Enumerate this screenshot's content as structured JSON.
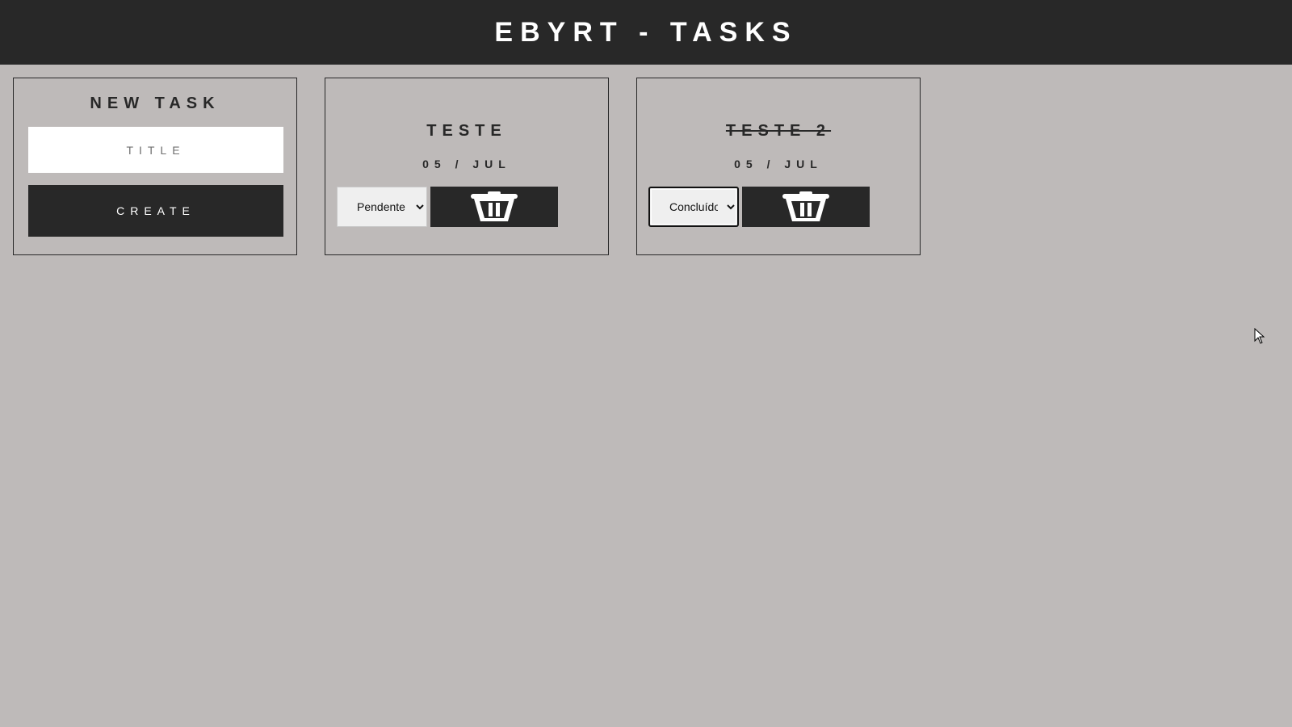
{
  "app": {
    "title": "EBYRT - TASKS"
  },
  "new_task": {
    "heading": "NEW TASK",
    "title_input": {
      "placeholder": "TITLE",
      "value": ""
    },
    "create_label": "CREATE"
  },
  "tasks": [
    {
      "title": "TESTE",
      "date": "05 / JUL",
      "status": "Pendente",
      "completed": false,
      "delete_icon": "trash-icon"
    },
    {
      "title": "TESTE 2",
      "date": "05 / JUL",
      "status": "Concluído",
      "completed": true,
      "delete_icon": "trash-icon"
    }
  ],
  "colors": {
    "header_bg": "#282828",
    "page_bg": "#bebab9",
    "button_bg": "#282828",
    "text_dark": "#282828",
    "text_light": "#ffffff"
  }
}
